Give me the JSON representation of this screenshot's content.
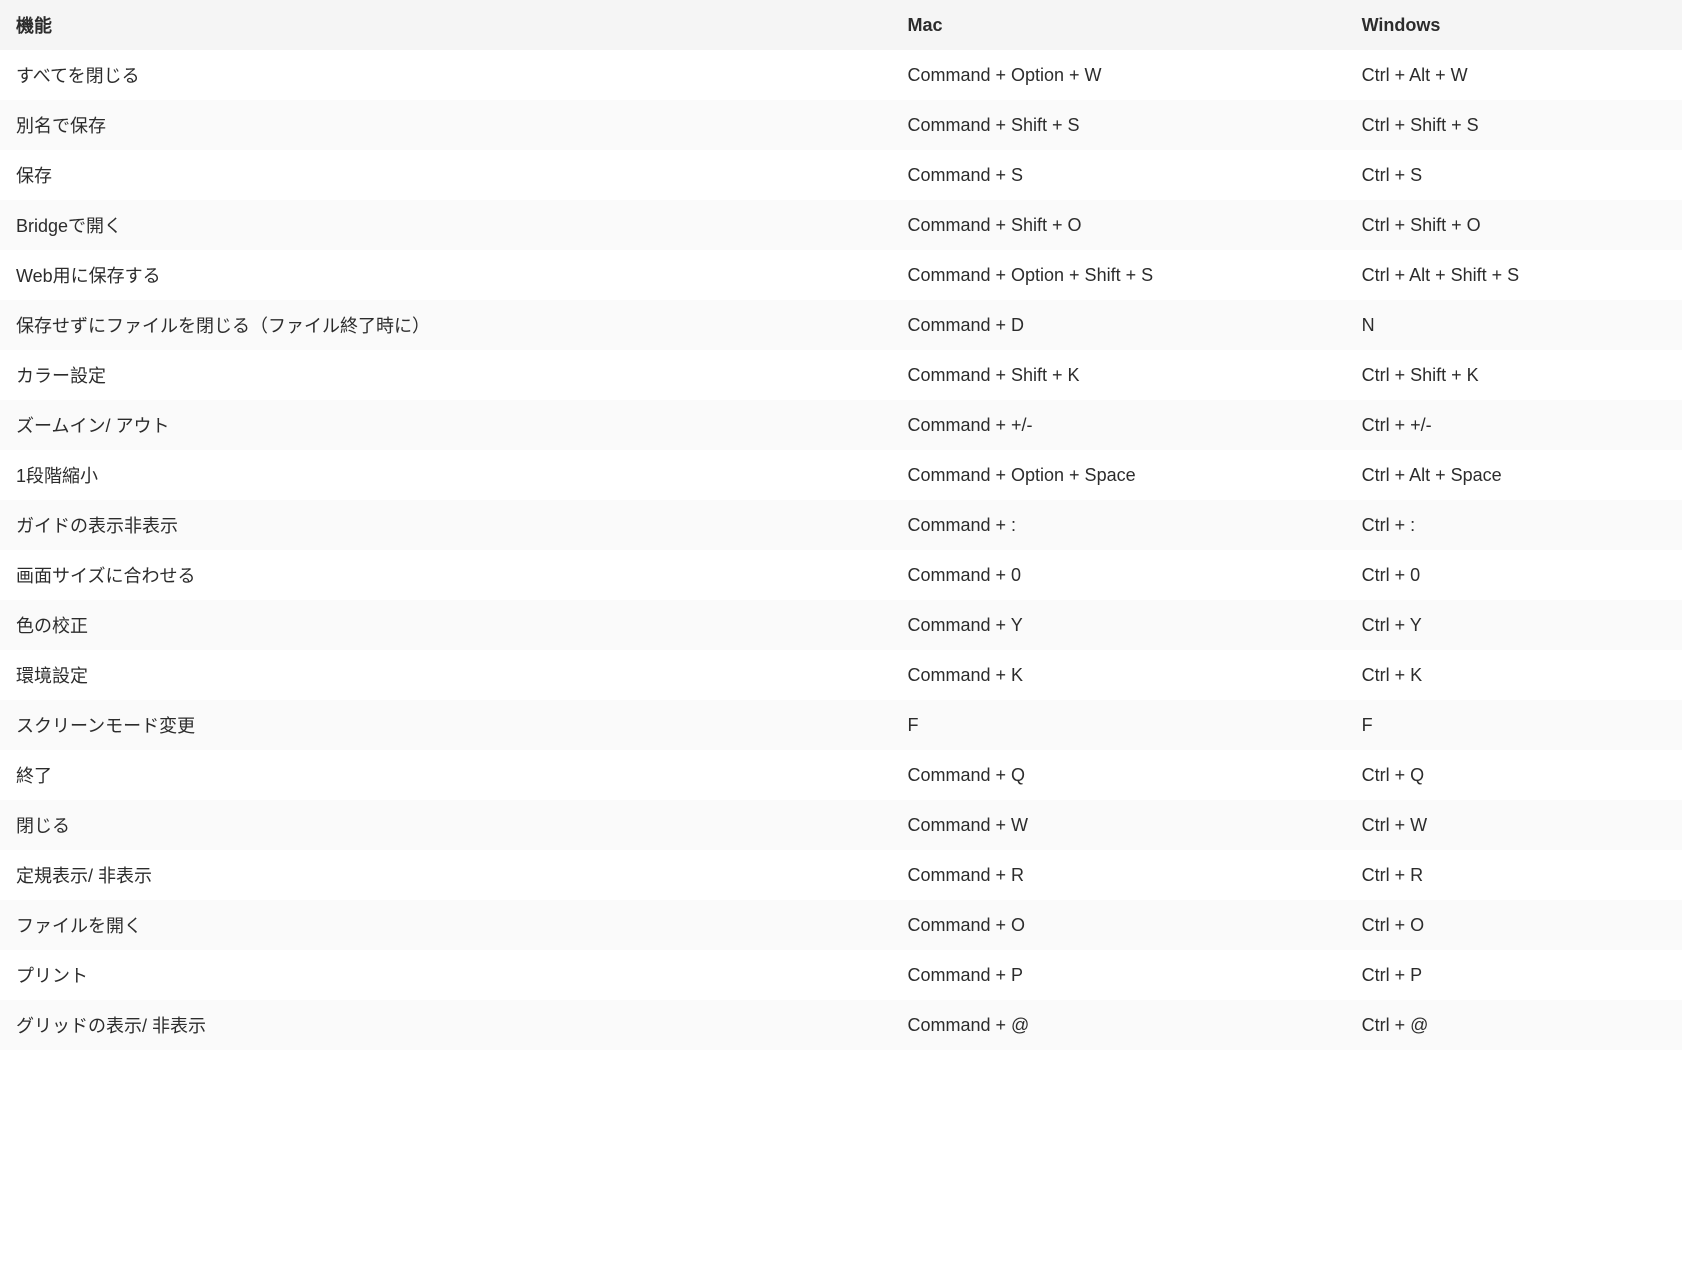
{
  "table": {
    "headers": {
      "feature": "機能",
      "mac": "Mac",
      "windows": "Windows"
    },
    "rows": [
      {
        "feature": "すべてを閉じる",
        "mac": "Command + Option + W",
        "windows": "Ctrl + Alt + W"
      },
      {
        "feature": "別名で保存",
        "mac": "Command + Shift + S",
        "windows": "Ctrl + Shift + S"
      },
      {
        "feature": "保存",
        "mac": "Command + S",
        "windows": "Ctrl + S"
      },
      {
        "feature": "Bridgeで開く",
        "mac": "Command + Shift + O",
        "windows": "Ctrl + Shift + O"
      },
      {
        "feature": "Web用に保存する",
        "mac": "Command + Option + Shift + S",
        "windows": "Ctrl + Alt + Shift + S"
      },
      {
        "feature": "保存せずにファイルを閉じる（ファイル終了時に）",
        "mac": "Command + D",
        "windows": "N"
      },
      {
        "feature": "カラー設定",
        "mac": "Command + Shift + K",
        "windows": "Ctrl + Shift + K"
      },
      {
        "feature": "ズームイン/ アウト",
        "mac": "Command + +/-",
        "windows": "Ctrl + +/-"
      },
      {
        "feature": "1段階縮小",
        "mac": "Command + Option + Space",
        "windows": "Ctrl + Alt + Space"
      },
      {
        "feature": "ガイドの表示非表示",
        "mac": "Command + :",
        "windows": "Ctrl + :"
      },
      {
        "feature": "画面サイズに合わせる",
        "mac": "Command + 0",
        "windows": "Ctrl + 0"
      },
      {
        "feature": "色の校正",
        "mac": "Command + Y",
        "windows": "Ctrl + Y"
      },
      {
        "feature": "環境設定",
        "mac": "Command + K",
        "windows": "Ctrl + K"
      },
      {
        "feature": "スクリーンモード変更",
        "mac": "F",
        "windows": "F"
      },
      {
        "feature": "終了",
        "mac": "Command + Q",
        "windows": "Ctrl + Q"
      },
      {
        "feature": "閉じる",
        "mac": "Command + W",
        "windows": "Ctrl + W"
      },
      {
        "feature": "定規表示/ 非表示",
        "mac": "Command + R",
        "windows": "Ctrl + R"
      },
      {
        "feature": "ファイルを開く",
        "mac": "Command + O",
        "windows": "Ctrl + O"
      },
      {
        "feature": "プリント",
        "mac": "Command + P",
        "windows": "Ctrl + P"
      },
      {
        "feature": "グリッドの表示/ 非表示",
        "mac": "Command + @",
        "windows": "Ctrl + @"
      }
    ]
  }
}
